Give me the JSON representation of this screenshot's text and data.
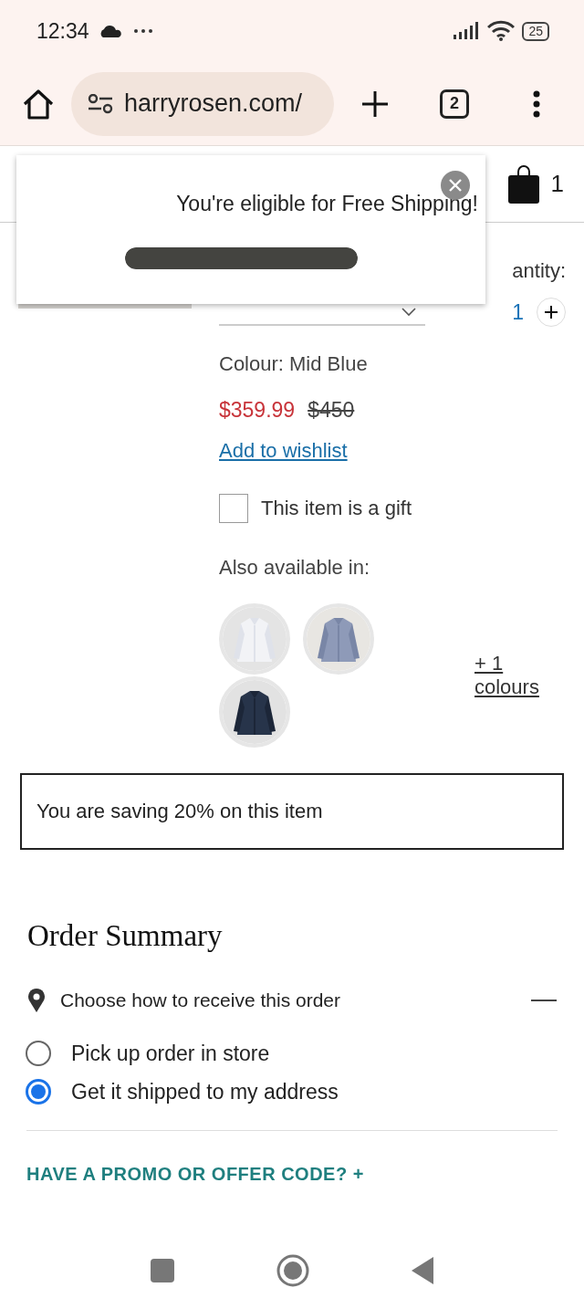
{
  "status_bar": {
    "time": "12:34",
    "battery": "25"
  },
  "browser": {
    "url": "harryrosen.com/",
    "tab_count": "2"
  },
  "header": {
    "cart_count": "1"
  },
  "popup": {
    "message": "You're eligible for Free Shipping!",
    "level": 1
  },
  "product": {
    "quantity_label": "antity:",
    "quantity": "1",
    "colour": "Colour: Mid Blue",
    "sale_price": "$359.99",
    "original_price": "$450",
    "wishlist": "Add to wishlist",
    "gift": {
      "label": "This item is a gift",
      "checked": false
    },
    "also_available": "Also available in:",
    "more_colours": "+ 1 colours"
  },
  "savings": "You are saving 20% on this item",
  "order_summary": {
    "title": "Order Summary",
    "receive": {
      "label": "Choose how to receive this order",
      "expanded": true
    },
    "options": [
      {
        "label": "Pick up order in store",
        "selected": false
      },
      {
        "label": "Get it shipped to my address",
        "selected": true
      }
    ],
    "promo": "HAVE A PROMO OR OFFER CODE? +"
  }
}
